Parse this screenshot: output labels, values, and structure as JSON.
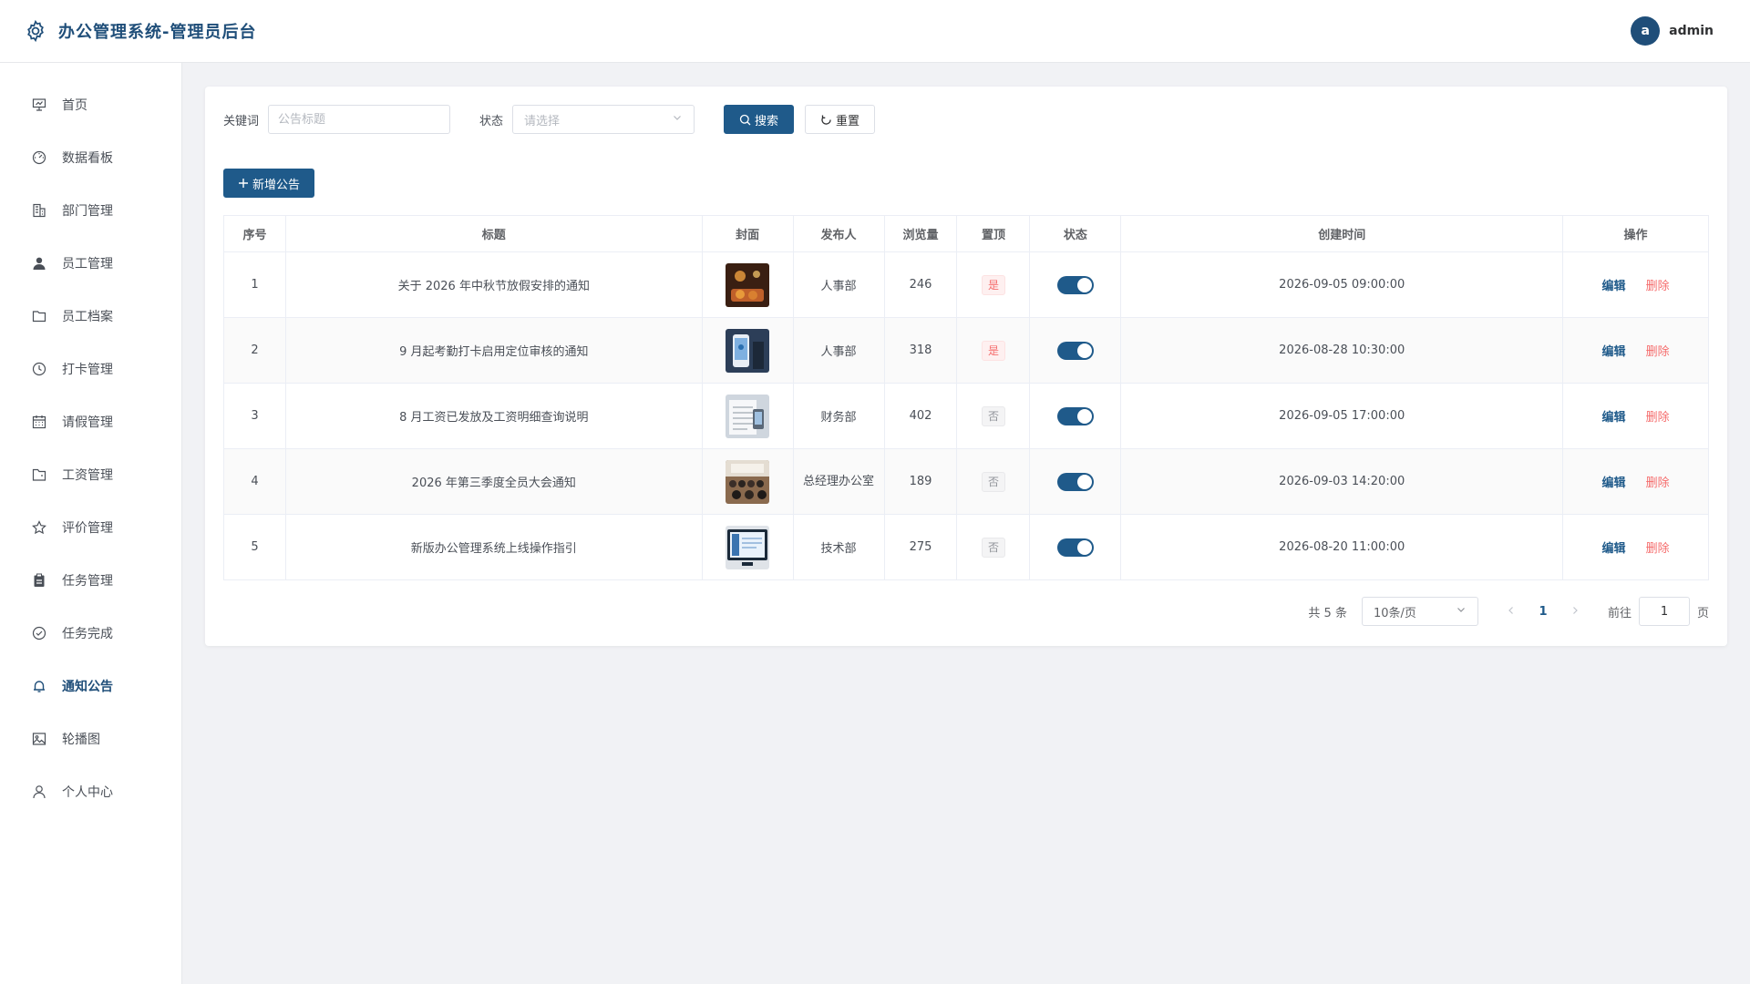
{
  "header": {
    "title": "办公管理系统-管理员后台",
    "logo_icon": "gear-icon",
    "avatar_letter": "a",
    "username": "admin"
  },
  "sidebar": {
    "active": "通知公告",
    "items": [
      {
        "label": "首页",
        "icon": "presentation-icon"
      },
      {
        "label": "数据看板",
        "icon": "dashboard-icon"
      },
      {
        "label": "部门管理",
        "icon": "building-icon"
      },
      {
        "label": "员工管理",
        "icon": "user-icon"
      },
      {
        "label": "员工档案",
        "icon": "folder-icon"
      },
      {
        "label": "打卡管理",
        "icon": "clock-icon"
      },
      {
        "label": "请假管理",
        "icon": "calendar-icon"
      },
      {
        "label": "工资管理",
        "icon": "wallet-icon"
      },
      {
        "label": "评价管理",
        "icon": "star-icon"
      },
      {
        "label": "任务管理",
        "icon": "clipboard-icon"
      },
      {
        "label": "任务完成",
        "icon": "check-circle-icon"
      },
      {
        "label": "通知公告",
        "icon": "bell-icon"
      },
      {
        "label": "轮播图",
        "icon": "picture-icon"
      },
      {
        "label": "个人中心",
        "icon": "person-icon"
      }
    ]
  },
  "search": {
    "keyword_label": "关键词",
    "keyword_placeholder": "公告标题",
    "status_label": "状态",
    "status_placeholder": "请选择",
    "search_button": "搜索",
    "reset_button": "重置"
  },
  "add_button": "新增公告",
  "table": {
    "columns": [
      "序号",
      "标题",
      "封面",
      "发布人",
      "浏览量",
      "置顶",
      "状态",
      "创建时间",
      "操作"
    ],
    "rows": [
      {
        "index": "1",
        "title": "关于 2026 年中秋节放假安排的通知",
        "cover": "festival",
        "publisher": "人事部",
        "views": "246",
        "pinned": "是",
        "status_on": true,
        "created": "2026-09-05 09:00:00"
      },
      {
        "index": "2",
        "title": "9 月起考勤打卡启用定位审核的通知",
        "cover": "phone",
        "publisher": "人事部",
        "views": "318",
        "pinned": "是",
        "status_on": true,
        "created": "2026-08-28 10:30:00"
      },
      {
        "index": "3",
        "title": "8 月工资已发放及工资明细查询说明",
        "cover": "document",
        "publisher": "财务部",
        "views": "402",
        "pinned": "否",
        "status_on": true,
        "created": "2026-09-05 17:00:00"
      },
      {
        "index": "4",
        "title": "2026 年第三季度全员大会通知",
        "cover": "meeting",
        "publisher": "总经理办公室",
        "views": "189",
        "pinned": "否",
        "status_on": true,
        "created": "2026-09-03 14:20:00"
      },
      {
        "index": "5",
        "title": "新版办公管理系统上线操作指引",
        "cover": "monitor",
        "publisher": "技术部",
        "views": "275",
        "pinned": "否",
        "status_on": true,
        "created": "2026-08-20 11:00:00"
      }
    ],
    "edit_label": "编辑",
    "delete_label": "删除"
  },
  "pagination": {
    "total_text": "共 5 条",
    "page_size": "10条/页",
    "current_page": "1",
    "goto_label": "前往",
    "goto_value": "1",
    "page_unit": "页"
  },
  "colors": {
    "primary": "#1f5a8a",
    "danger": "#f56c6c",
    "background": "#f1f2f5"
  }
}
